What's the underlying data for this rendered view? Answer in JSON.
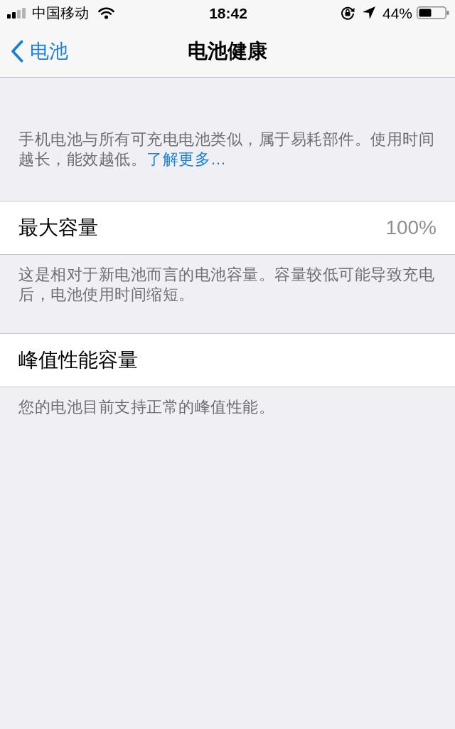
{
  "status_bar": {
    "carrier": "中国移动",
    "time": "18:42",
    "battery_percent": "44%"
  },
  "nav_bar": {
    "back_label": "电池",
    "title": "电池健康"
  },
  "intro": {
    "text": "手机电池与所有可充电电池类似，属于易耗部件。使用时间越长，能效越低。",
    "link": "了解更多…"
  },
  "sections": [
    {
      "label": "最大容量",
      "value": "100%",
      "footer": "这是相对于新电池而言的电池容量。容量较低可能导致充电后，电池使用时间缩短。"
    },
    {
      "label": "峰值性能容量",
      "footer": "您的电池目前支持正常的峰值性能。"
    }
  ]
}
